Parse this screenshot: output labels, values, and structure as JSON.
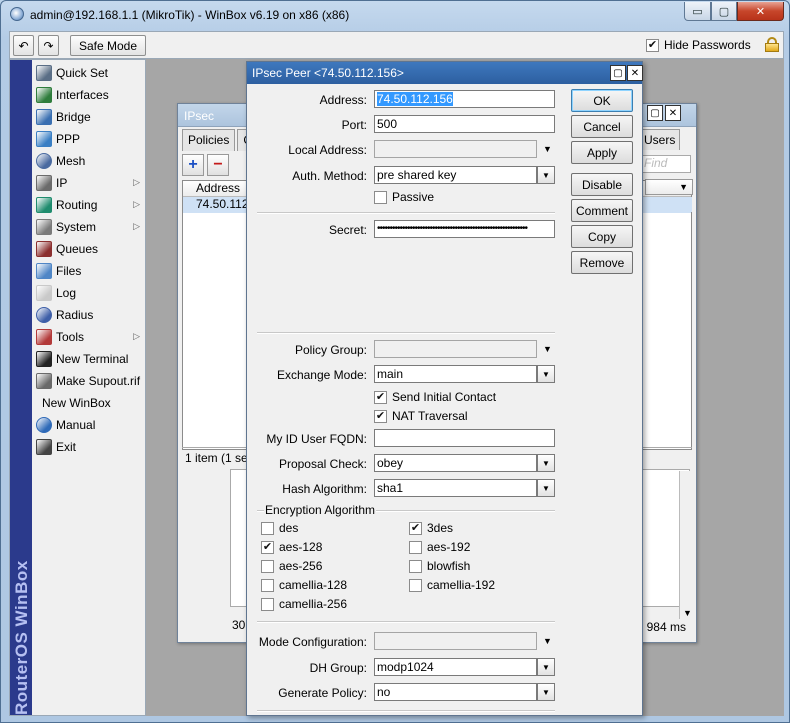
{
  "window": {
    "title": "admin@192.168.1.1 (MikroTik) - WinBox v6.19 on x86 (x86)",
    "min_glyph": "▭",
    "max_glyph": "▢",
    "close_glyph": "✕"
  },
  "toolbar": {
    "undo_glyph": "↶",
    "redo_glyph": "↷",
    "safe_mode_label": "Safe Mode",
    "hide_passwords_label": "Hide Passwords",
    "hide_passwords_checked": "✔"
  },
  "sidebar": {
    "brand": "RouterOS WinBox",
    "items": [
      {
        "label": "Quick Set",
        "icon": "quick-set-icon"
      },
      {
        "label": "Interfaces",
        "icon": "interfaces-icon"
      },
      {
        "label": "Bridge",
        "icon": "bridge-icon"
      },
      {
        "label": "PPP",
        "icon": "ppp-icon"
      },
      {
        "label": "Mesh",
        "icon": "mesh-icon"
      },
      {
        "label": "IP",
        "icon": "ip-icon",
        "submenu": "▷"
      },
      {
        "label": "Routing",
        "icon": "routing-icon",
        "submenu": "▷"
      },
      {
        "label": "System",
        "icon": "system-icon",
        "submenu": "▷"
      },
      {
        "label": "Queues",
        "icon": "queues-icon"
      },
      {
        "label": "Files",
        "icon": "files-icon"
      },
      {
        "label": "Log",
        "icon": "log-icon"
      },
      {
        "label": "Radius",
        "icon": "radius-icon"
      },
      {
        "label": "Tools",
        "icon": "tools-icon",
        "submenu": "▷"
      },
      {
        "label": "New Terminal",
        "icon": "terminal-icon"
      },
      {
        "label": "Make Supout.rif",
        "icon": "supout-icon"
      },
      {
        "label": "New WinBox",
        "icon": ""
      },
      {
        "label": "Manual",
        "icon": "manual-icon"
      },
      {
        "label": "Exit",
        "icon": "exit-icon"
      }
    ]
  },
  "ipsec_window": {
    "title": "IPsec",
    "tabs": [
      "Policies",
      "Gr"
    ],
    "add_glyph": "+",
    "remove_glyph": "−",
    "column_header": "Address",
    "row_address": "74.50.112.",
    "status": "1 item (1 sele",
    "lower_status": "30",
    "users_tab": "Users",
    "find_placeholder": "Find",
    "latency": "c: 984 ms"
  },
  "peer_dialog": {
    "title": "IPsec Peer <74.50.112.156>",
    "max_glyph": "▢",
    "close_glyph": "✕",
    "dropdown_glyph": "▼",
    "checked_glyph": "✔",
    "address_label": "Address:",
    "address_value": "74.50.112.156",
    "port_label": "Port:",
    "port_value": "500",
    "local_address_label": "Local Address:",
    "local_address_value": "",
    "auth_method_label": "Auth. Method:",
    "auth_method_value": "pre shared key",
    "passive_label": "Passive",
    "secret_label": "Secret:",
    "secret_value": "••••••••••••••••••••••••••••••••••••••••••••••••••••••••••••",
    "policy_group_label": "Policy Group:",
    "policy_group_value": "",
    "exchange_mode_label": "Exchange Mode:",
    "exchange_mode_value": "main",
    "send_initial_contact_label": "Send Initial Contact",
    "nat_traversal_label": "NAT Traversal",
    "my_id_label": "My ID User FQDN:",
    "my_id_value": "",
    "proposal_check_label": "Proposal Check:",
    "proposal_check_value": "obey",
    "hash_algorithm_label": "Hash Algorithm:",
    "hash_algorithm_value": "sha1",
    "encryption_legend": "Encryption Algorithm",
    "encryption": [
      {
        "label": "des",
        "checked": false
      },
      {
        "label": "3des",
        "checked": true
      },
      {
        "label": "aes-128",
        "checked": true
      },
      {
        "label": "aes-192",
        "checked": false
      },
      {
        "label": "aes-256",
        "checked": false
      },
      {
        "label": "blowfish",
        "checked": false
      },
      {
        "label": "camellia-128",
        "checked": false
      },
      {
        "label": "camellia-192",
        "checked": false
      },
      {
        "label": "camellia-256",
        "checked": false
      }
    ],
    "mode_config_label": "Mode Configuration:",
    "mode_config_value": "",
    "dh_group_label": "DH Group:",
    "dh_group_value": "modp1024",
    "generate_policy_label": "Generate Policy:",
    "generate_policy_value": "no",
    "buttons": {
      "ok": "OK",
      "cancel": "Cancel",
      "apply": "Apply",
      "disable": "Disable",
      "comment": "Comment",
      "copy": "Copy",
      "remove": "Remove"
    }
  }
}
